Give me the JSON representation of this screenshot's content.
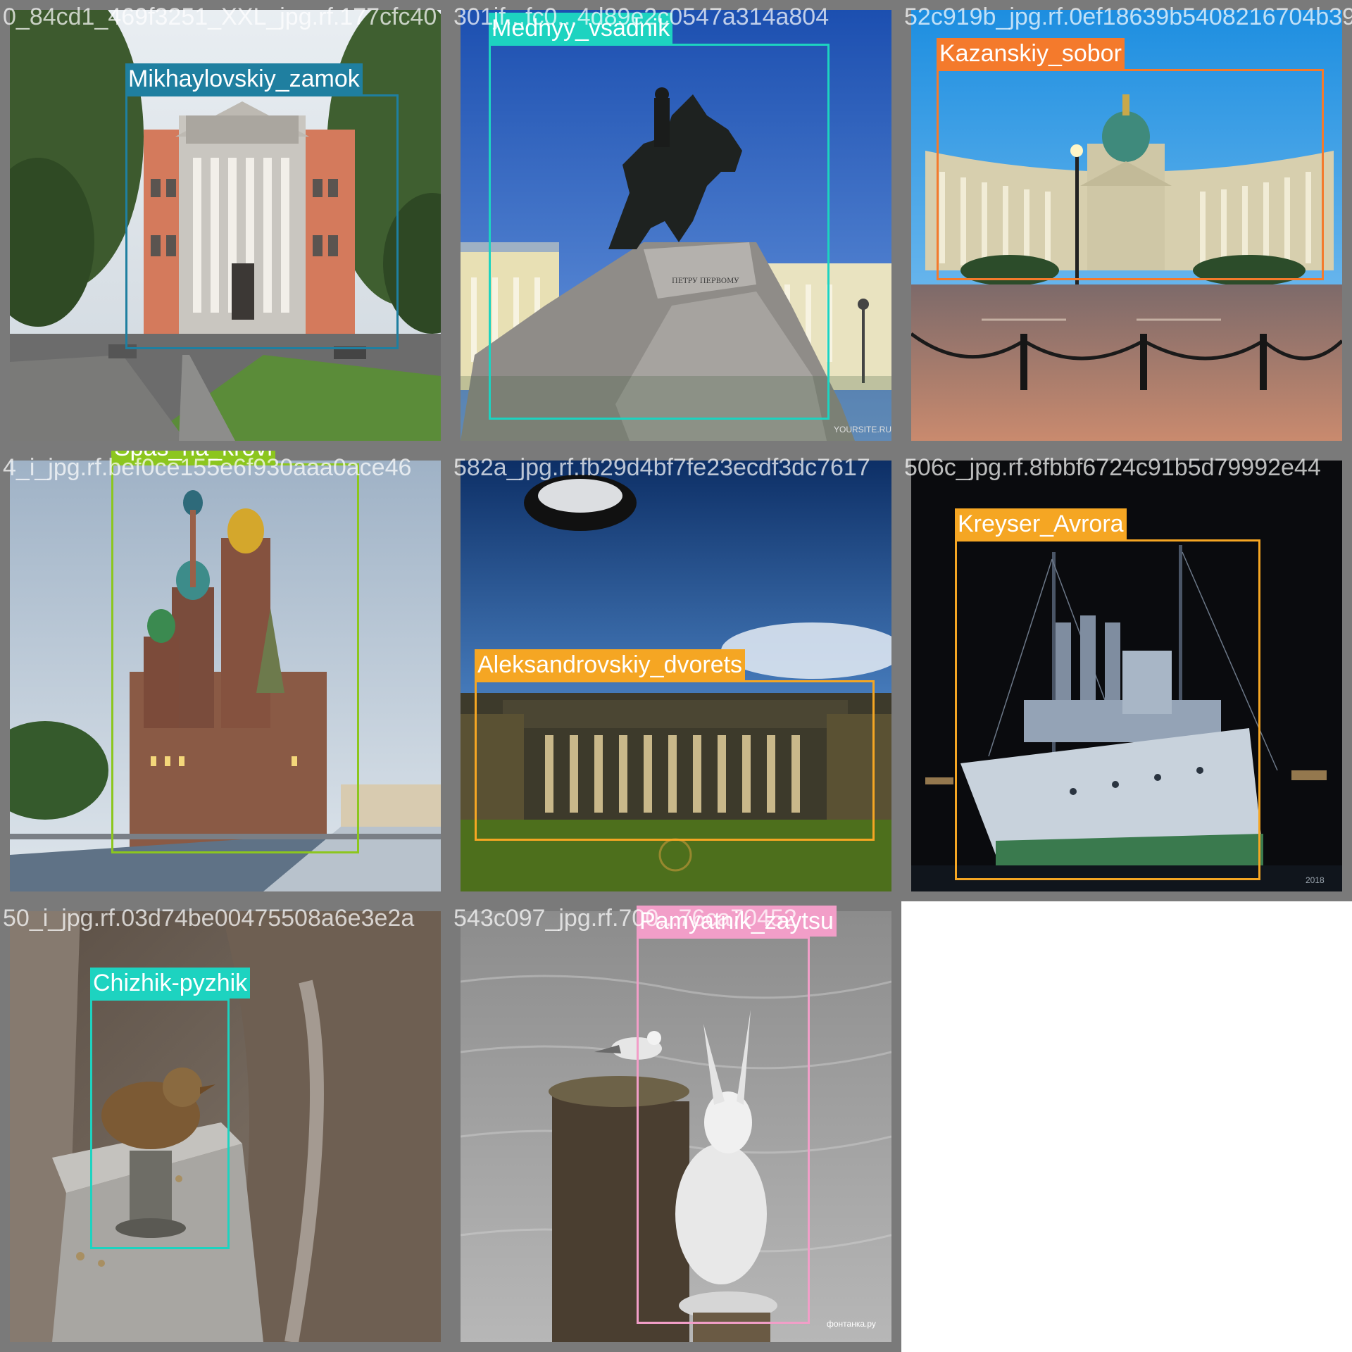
{
  "tiles": [
    {
      "filename": "0_84cd1_469f3251_XXL_jpg.rf.177cfc40",
      "class_name": "Mikhaylovskiy_zamok",
      "color": "#1f7fa0",
      "scene": "palace-photo"
    },
    {
      "filename": "301jf...fc0...4d89e2c0547a314a804",
      "class_name": "Mednyy_vsadnik",
      "color": "#1dd3c0",
      "scene": "bronze-horseman-photo"
    },
    {
      "filename": "52c919b_jpg.rf.0ef18639b5408216704b39",
      "class_name": "Kazanskiy_sobor",
      "color": "#f47a2c",
      "scene": "cathedral-photo"
    },
    {
      "filename": "4_i_jpg.rf.bef0ce155e6f930aaa0ace46",
      "class_name": "Spas_na_krovi",
      "color": "#8cc61e",
      "scene": "church-photo"
    },
    {
      "filename": "582a_jpg.rf.fb29d4bf7fe23ecdf3dc7617",
      "class_name": "Aleksandrovskiy_dvorets",
      "color": "#f5a623",
      "scene": "palace-night-photo"
    },
    {
      "filename": "506c_jpg.rf.8fbbf6724c91b5d79992e44",
      "class_name": "Kreyser_Avrora",
      "color": "#f5a623",
      "scene": "cruiser-photo"
    },
    {
      "filename": "50_i_jpg.rf.03d74be00475508a6e3e2a",
      "class_name": "Chizhik-pyzhik",
      "color": "#1dd3c0",
      "scene": "bird-statue-photo"
    },
    {
      "filename": "543c097_jpg.rf.700...76ca70452",
      "class_name": "Pamyatnik_zaytsu",
      "color": "#f29ec8",
      "scene": "hare-statue-photo"
    }
  ],
  "watermarks": {
    "horseman": "YOURSITE.RU",
    "avrora": "2018",
    "hare": "фонтанка.ру"
  }
}
